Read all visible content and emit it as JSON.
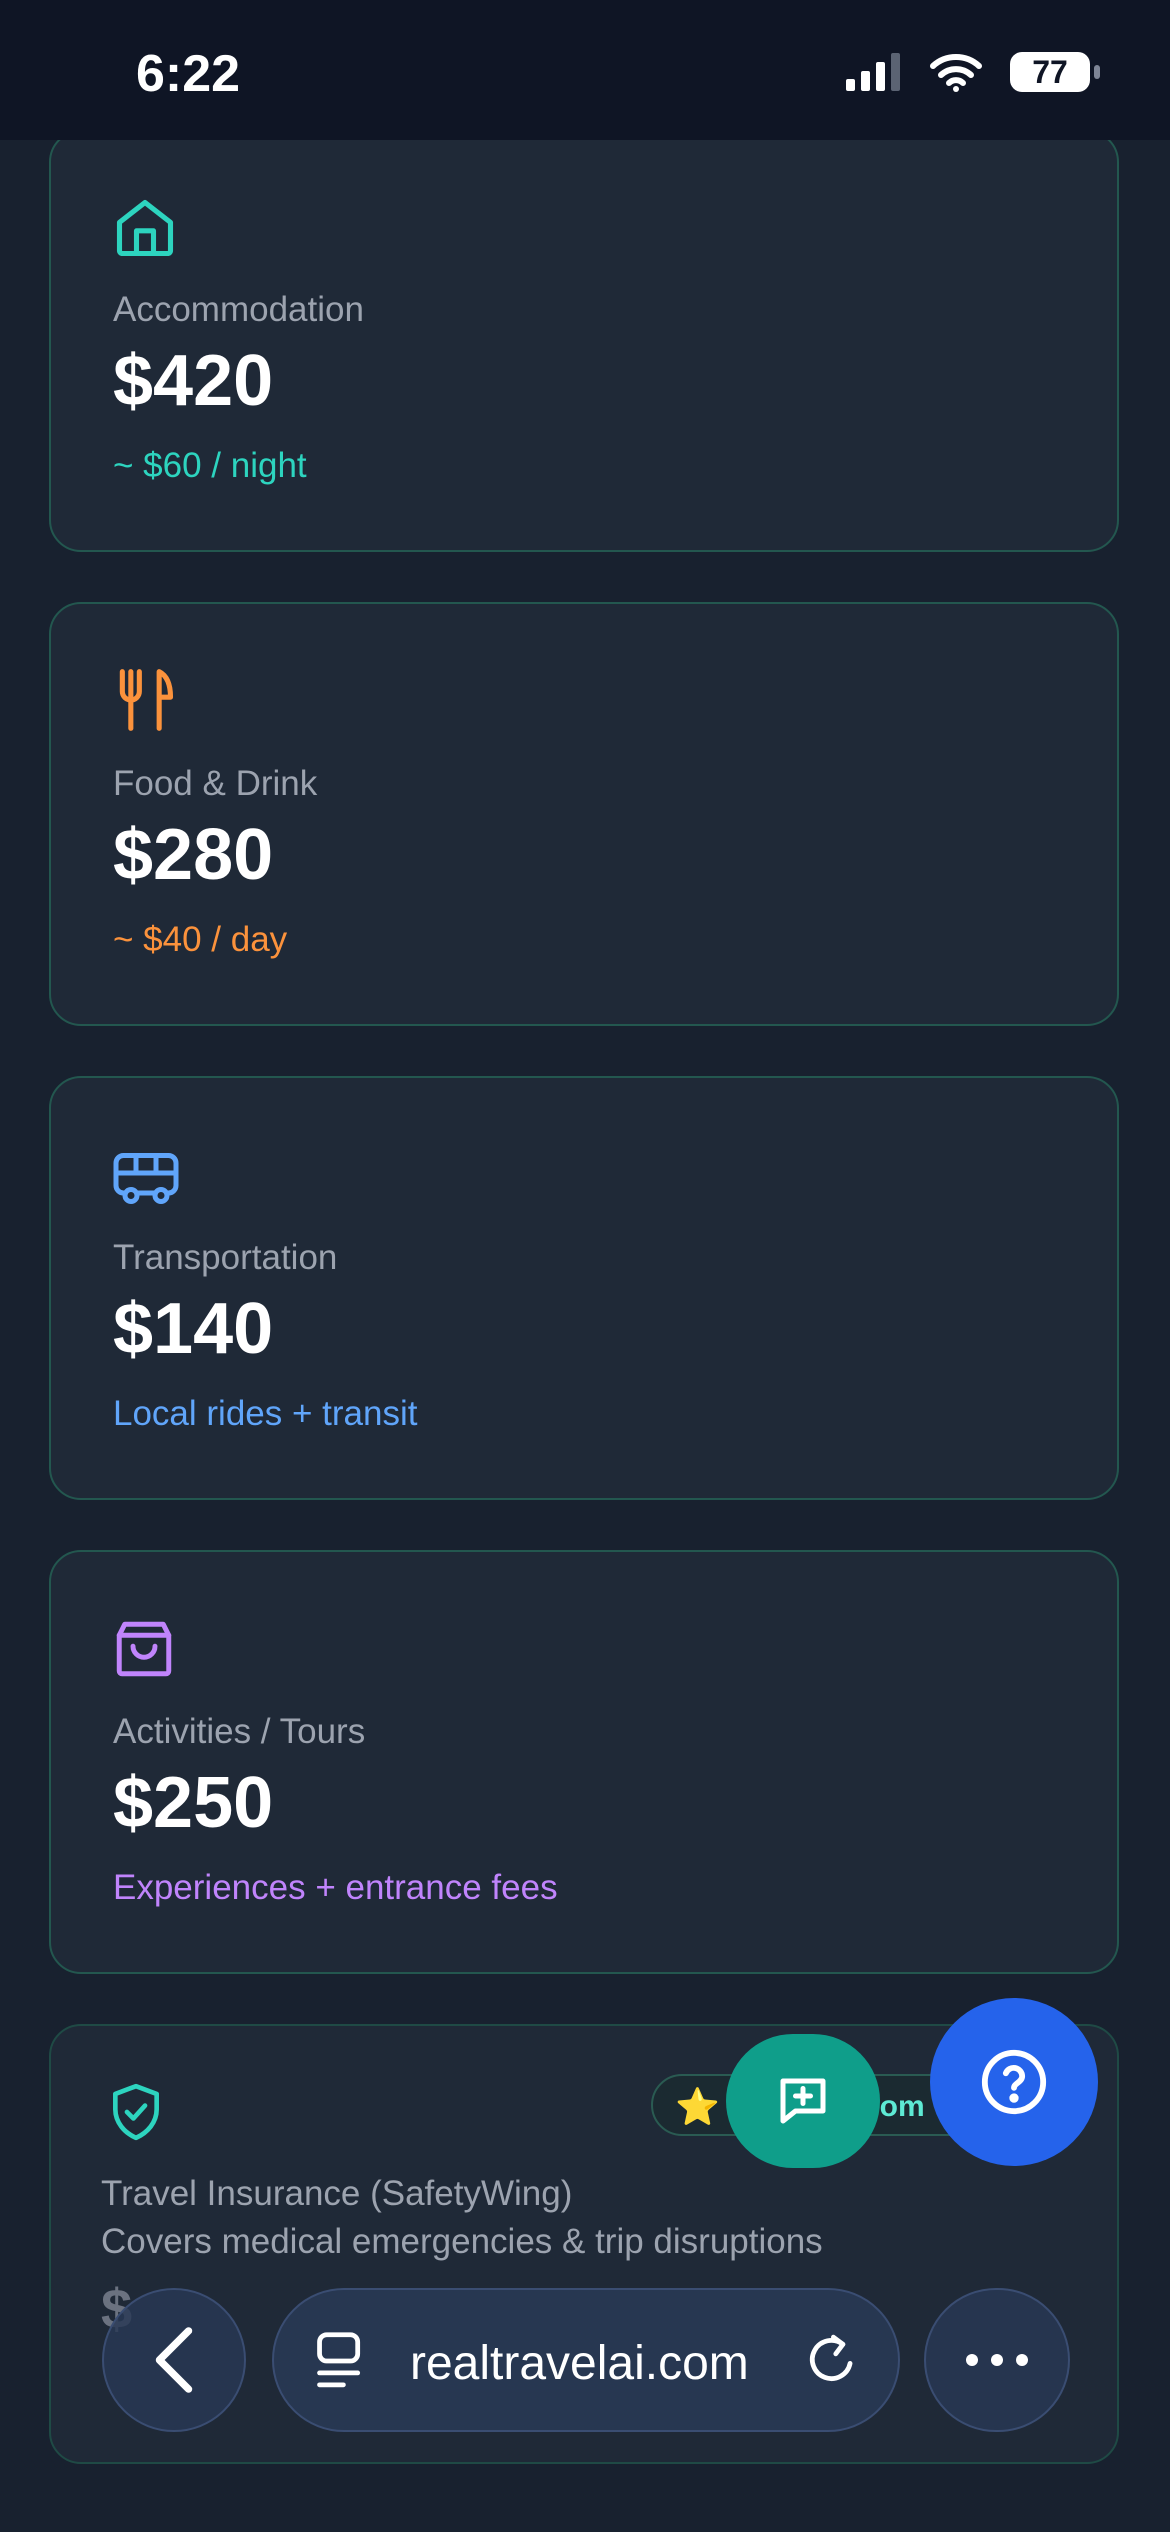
{
  "status_bar": {
    "time": "6:22",
    "battery": "77"
  },
  "cards": [
    {
      "label": "Accommodation",
      "amount": "$420",
      "note": "~ $60 / night",
      "color": "#2dd4bf",
      "icon": "house-icon"
    },
    {
      "label": "Food & Drink",
      "amount": "$280",
      "note": "~ $40 / day",
      "color": "#fb923c",
      "icon": "fork-knife-icon"
    },
    {
      "label": "Transportation",
      "amount": "$140",
      "note": "Local rides + transit",
      "color": "#60a5fa",
      "icon": "bus-icon"
    },
    {
      "label": "Activities / Tours",
      "amount": "$250",
      "note": "Experiences + entrance fees",
      "color": "#c084fc",
      "icon": "shopping-bag-icon"
    }
  ],
  "insurance": {
    "title": "Travel Insurance (SafetyWing)",
    "subtitle": "Covers medical emergencies & trip disruptions",
    "amount_partial": "$",
    "badge_icon": "star-icon",
    "badge_text": "com",
    "color": "#2dd4bf",
    "icon": "shield-check-icon"
  },
  "fab": {
    "chat_icon": "message-plus-icon",
    "help_icon": "help-circle-icon"
  },
  "browser": {
    "url": "realtravelai.com"
  }
}
